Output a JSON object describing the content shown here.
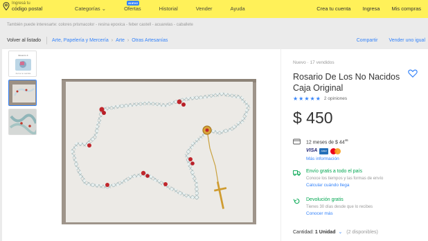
{
  "header": {
    "location_small": "Ingresá tu",
    "location_big": "código postal",
    "nav": [
      {
        "label": "Categorías ⌄",
        "badge": ""
      },
      {
        "label": "Ofertas",
        "badge": "NUEVO"
      },
      {
        "label": "Historial",
        "badge": ""
      },
      {
        "label": "Vender",
        "badge": ""
      },
      {
        "label": "Ayuda",
        "badge": ""
      }
    ],
    "right_nav": [
      "Crea tu cuenta",
      "Ingresa",
      "Mis compras"
    ]
  },
  "interest_text": "También puede interesarte: colores prismacolor - resina epoxica - feber castell - acuarelas - caballete",
  "breadcrumb": {
    "back": "Volver al listado",
    "items": [
      "Arte, Papelería y Mercería",
      "Arte",
      "Otras Artesanías"
    ],
    "share": "Compartir",
    "sell": "Vender uno igual"
  },
  "product": {
    "condition": "Nuevo  ·  17 vendidos",
    "title": "Rosario De Los No Nacidos Caja Original",
    "rating_stars": 5,
    "reviews": "2 opiniones",
    "price": "$ 450",
    "installments": "12 meses de $ 44",
    "installments_cents": "46",
    "more_info": "Más información",
    "shipping_title": "Envío gratis a todo el país",
    "shipping_desc": "Conoce los tiempos y las formas de envío",
    "shipping_link": "Calcular cuándo llega",
    "return_title": "Devolución gratis",
    "return_desc": "Tienes 30 días desde que lo recibes",
    "return_link": "Conocer más",
    "quantity_label": "Cantidad:",
    "quantity_value": "1 Unidad",
    "quantity_chevron": "⌄",
    "available": "(2 disponibles)"
  },
  "thumbnail_text": {
    "caption_top": "Rosario X",
    "caption_bottom": "de los no nacidos"
  },
  "colors": {
    "header_yellow": "#fff159",
    "link_blue": "#3483fa",
    "success_green": "#00a650"
  },
  "icons": [
    "location-pin-icon",
    "heart-icon",
    "credit-card-icon",
    "truck-icon",
    "return-icon",
    "star-icon",
    "visa-logo",
    "amex-logo",
    "mastercard-logo"
  ]
}
